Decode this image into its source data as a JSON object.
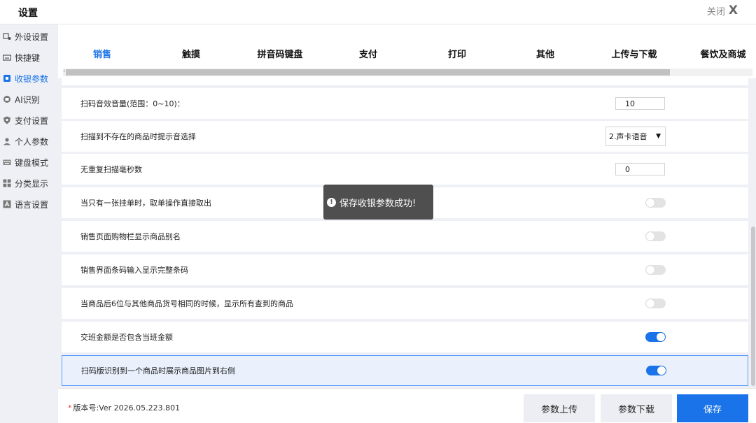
{
  "window": {
    "title": "设置",
    "close_label": "关闭",
    "close_glyph": "X"
  },
  "sidebar": {
    "items": [
      {
        "label": "外设设置",
        "icon": "peripheral-icon"
      },
      {
        "label": "快捷键",
        "icon": "keyboard-icon"
      },
      {
        "label": "收银参数",
        "icon": "cashier-icon",
        "active": true
      },
      {
        "label": "AI识别",
        "icon": "ai-icon"
      },
      {
        "label": "支付设置",
        "icon": "shield-icon"
      },
      {
        "label": "个人参数",
        "icon": "user-icon"
      },
      {
        "label": "键盘模式",
        "icon": "keyboard-mode-icon"
      },
      {
        "label": "分类显示",
        "icon": "grid-icon"
      },
      {
        "label": "语言设置",
        "icon": "language-icon"
      }
    ]
  },
  "tabs": [
    {
      "label": "销售",
      "active": true
    },
    {
      "label": "触摸"
    },
    {
      "label": "拼音码键盘"
    },
    {
      "label": "支付"
    },
    {
      "label": "打印"
    },
    {
      "label": "其他"
    },
    {
      "label": "上传与下载"
    },
    {
      "label": "餐饮及商城"
    }
  ],
  "settings": [
    {
      "label": "扫码音效音量(范围：0~10)：",
      "type": "number",
      "value": "10"
    },
    {
      "label": "扫描到不存在的商品时提示音选择",
      "type": "select",
      "value": "2.声卡语音"
    },
    {
      "label": "无重复扫描毫秒数",
      "type": "number",
      "value": "0"
    },
    {
      "label": "当只有一张挂单时，取单操作直接取出",
      "type": "toggle",
      "value": false
    },
    {
      "label": "销售页面购物栏显示商品别名",
      "type": "toggle",
      "value": false
    },
    {
      "label": "销售界面条码输入显示完整条码",
      "type": "toggle",
      "value": false
    },
    {
      "label": "当商品后6位与其他商品货号相同的时候，显示所有查到的商品",
      "type": "toggle",
      "value": false
    },
    {
      "label": "交班金额是否包含当班金额",
      "type": "toggle",
      "value": true
    },
    {
      "label": "扫码版识别到一个商品时展示商品图片到右侧",
      "type": "toggle",
      "value": true,
      "selected": true
    }
  ],
  "toast": {
    "message": "保存收银参数成功!",
    "icon": "info-icon"
  },
  "footer": {
    "version_star": "*",
    "version": "版本号:Ver 2026.05.223.801",
    "upload_label": "参数上传",
    "download_label": "参数下载",
    "save_label": "保存"
  },
  "colors": {
    "accent": "#1a73e8",
    "sidebar_bg": "#eef0f6",
    "toggle_off": "#e3e3e3"
  }
}
